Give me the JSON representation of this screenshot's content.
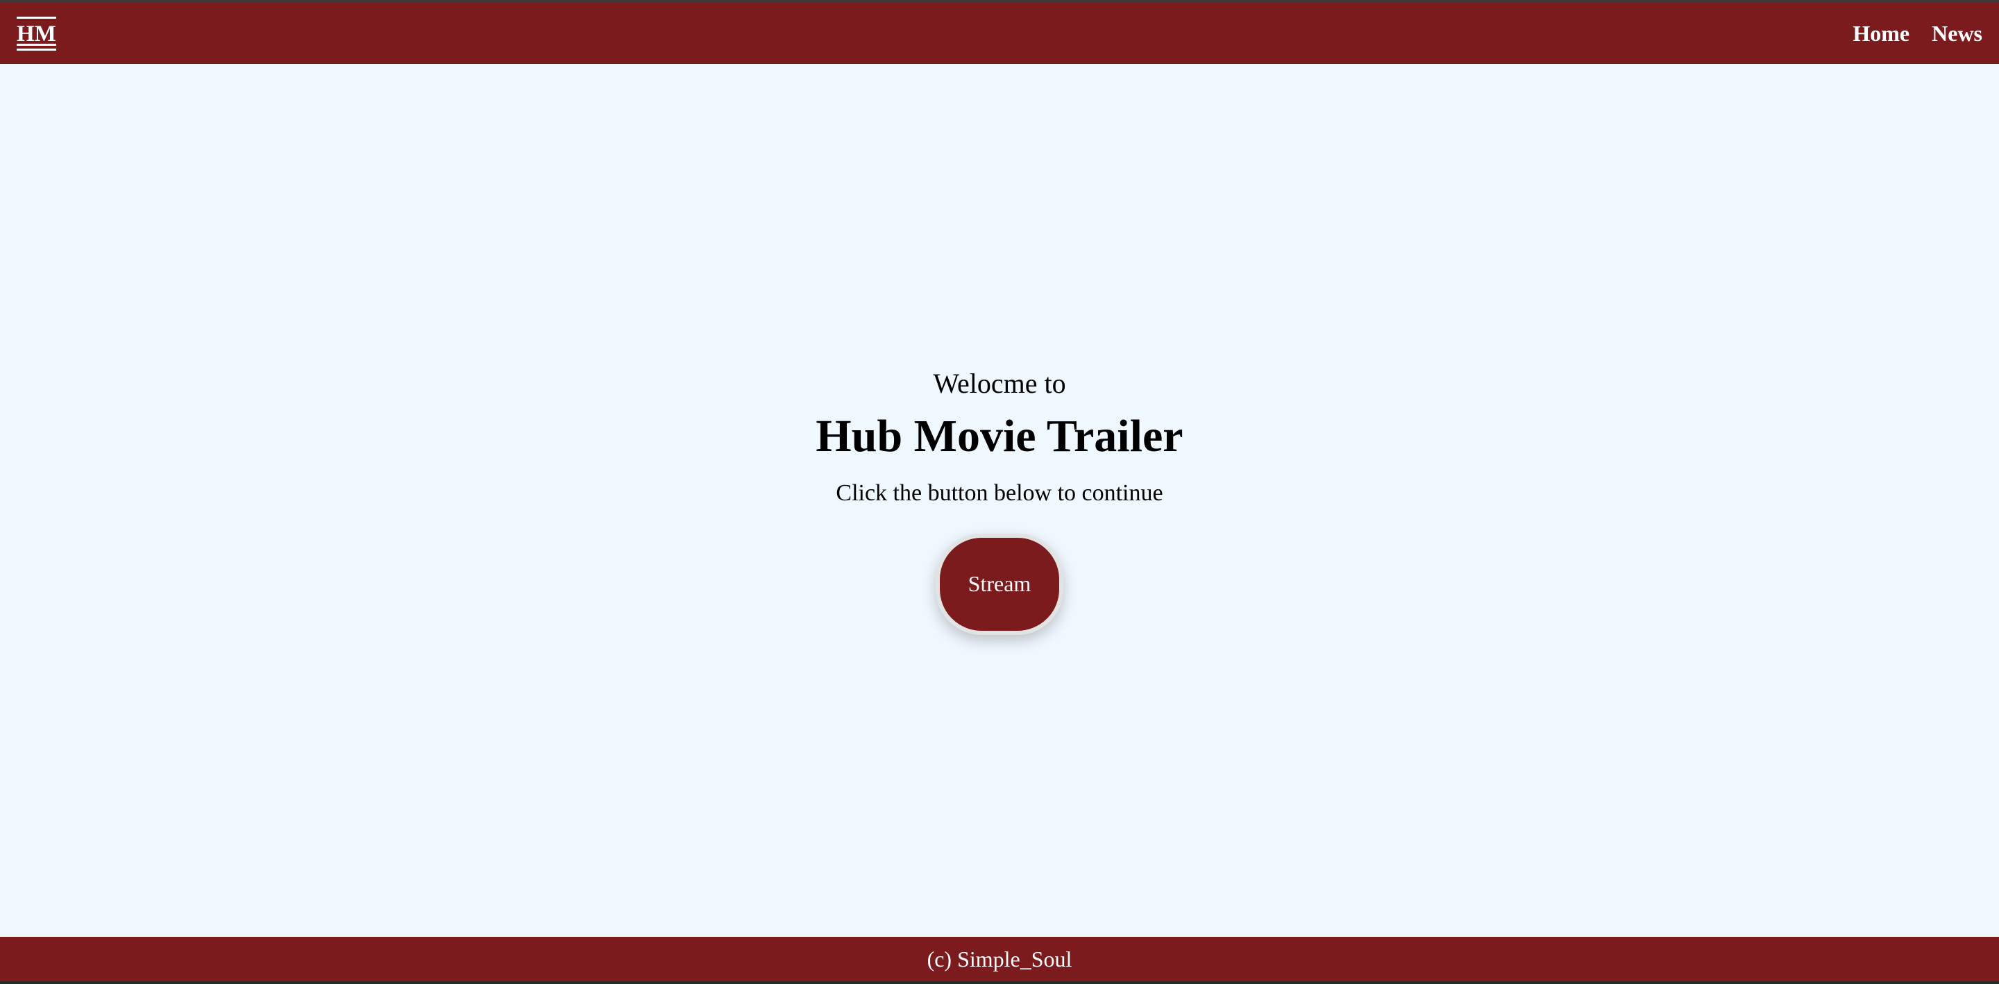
{
  "header": {
    "logo_text": "HM",
    "nav": [
      {
        "label": "Home"
      },
      {
        "label": "News"
      }
    ]
  },
  "main": {
    "welcome": "Welocme to",
    "title": "Hub Movie Trailer",
    "subtitle": "Click the button below to continue",
    "button_label": "Stream"
  },
  "footer": {
    "text": "(c) Simple_Soul"
  },
  "colors": {
    "brand": "#7b1b1d",
    "background": "#f0f8ff",
    "text_on_brand": "#ffffff"
  }
}
